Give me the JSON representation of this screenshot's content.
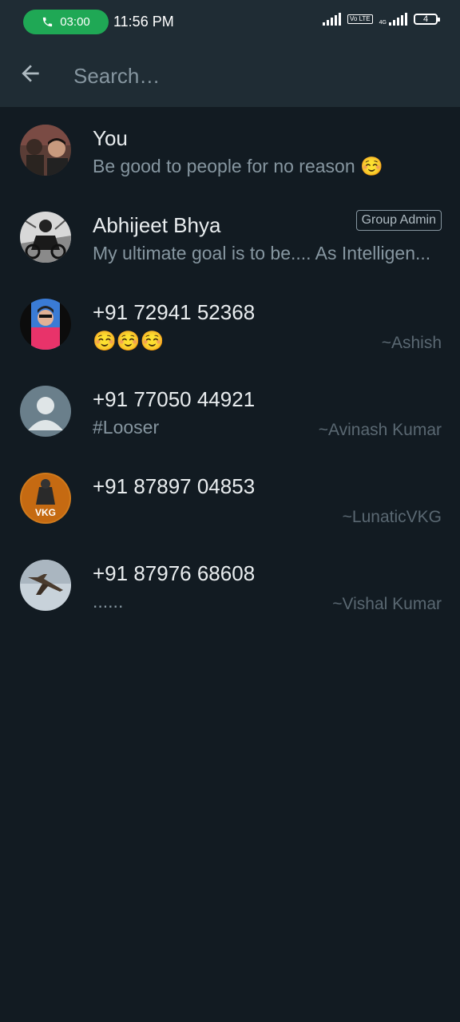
{
  "status_bar": {
    "call_timer": "03:00",
    "time": "11:56 PM",
    "volte_label": "Vo LTE",
    "network_label": "4G",
    "battery_level": "4"
  },
  "app_bar": {
    "search_placeholder": "Search…"
  },
  "participants": [
    {
      "name": "You",
      "about": "Be good to people for no reason ☺️",
      "push_name": "",
      "badge": ""
    },
    {
      "name": "Abhijeet Bhya",
      "about": "My ultimate goal is to be.... As Intelligen...",
      "push_name": "",
      "badge": "Group Admin"
    },
    {
      "name": "+91 72941 52368",
      "about": "☺️☺️☺️",
      "push_name": "~Ashish",
      "badge": ""
    },
    {
      "name": "+91 77050 44921",
      "about": "#Looser",
      "push_name": "~Avinash Kumar",
      "badge": ""
    },
    {
      "name": "+91 87897 04853",
      "about": "",
      "push_name": "~LunaticVKG",
      "badge": ""
    },
    {
      "name": "+91 87976 68608",
      "about": "......",
      "push_name": "~Vishal Kumar",
      "badge": ""
    }
  ],
  "avatar_labels": {
    "vkg": "VKG"
  },
  "colors": {
    "background": "#121b22",
    "header": "#1f2c34",
    "call_pill": "#1fa855",
    "primary_text": "#e9edef",
    "secondary_text": "#8696a0"
  }
}
